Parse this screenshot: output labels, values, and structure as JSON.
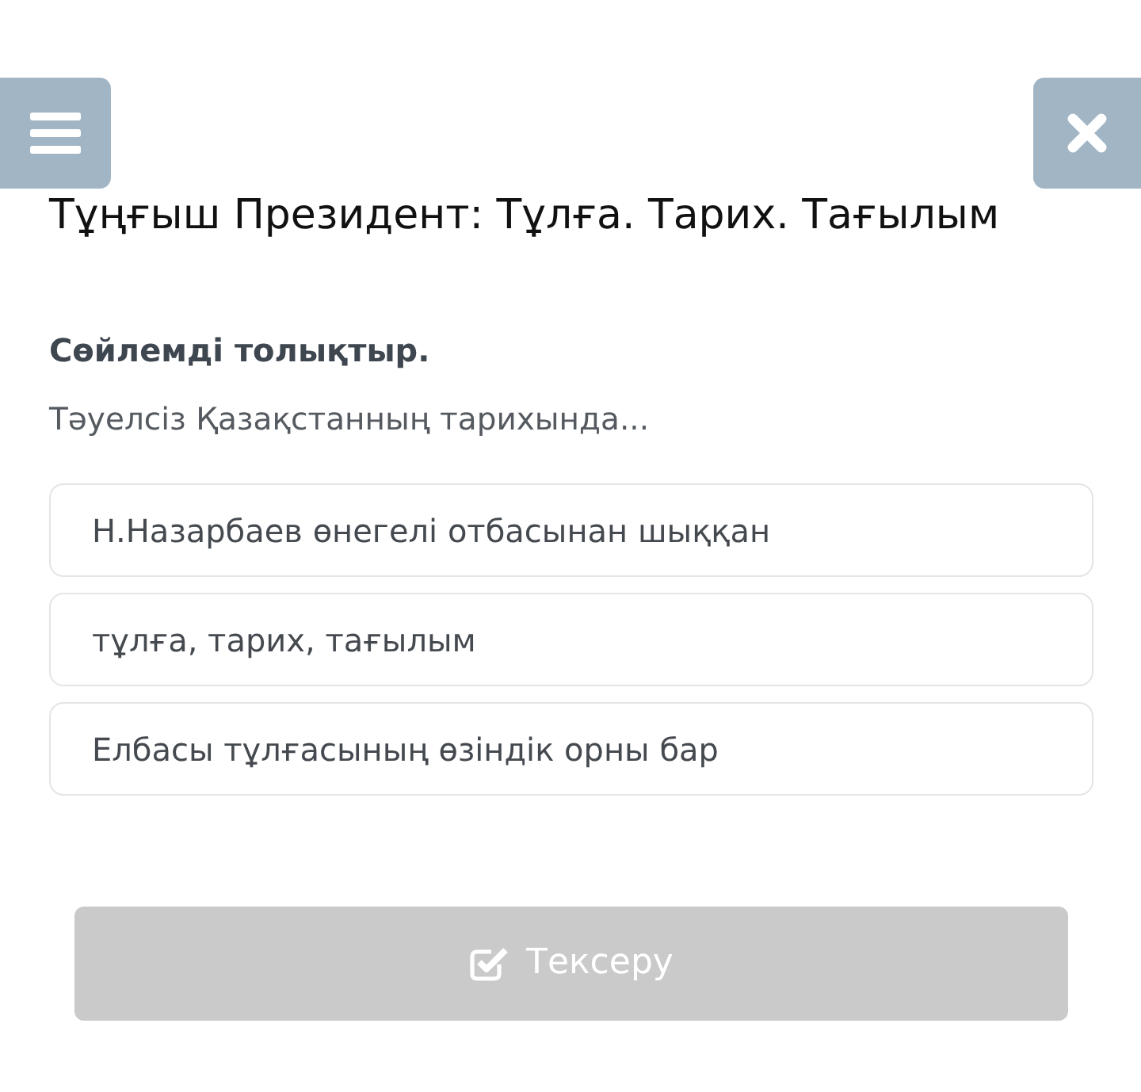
{
  "header": {
    "title": "Тұңғыш Президент: Тұлға. Тарих. Тағылым"
  },
  "question": {
    "instruction": "Сөйлемді толықтыр.",
    "prompt": "Тәуелсіз Қазақстанның тарихында..."
  },
  "options": [
    {
      "label": "Н.Назарбаев өнегелі отбасынан шыққан",
      "selected": false
    },
    {
      "label": "тұлға, тарих, тағылым",
      "selected": false
    },
    {
      "label": "Елбасы тұлғасының өзіндік орны бар",
      "selected": false
    }
  ],
  "check_button": {
    "label": "Тексеру",
    "disabled": true
  }
}
